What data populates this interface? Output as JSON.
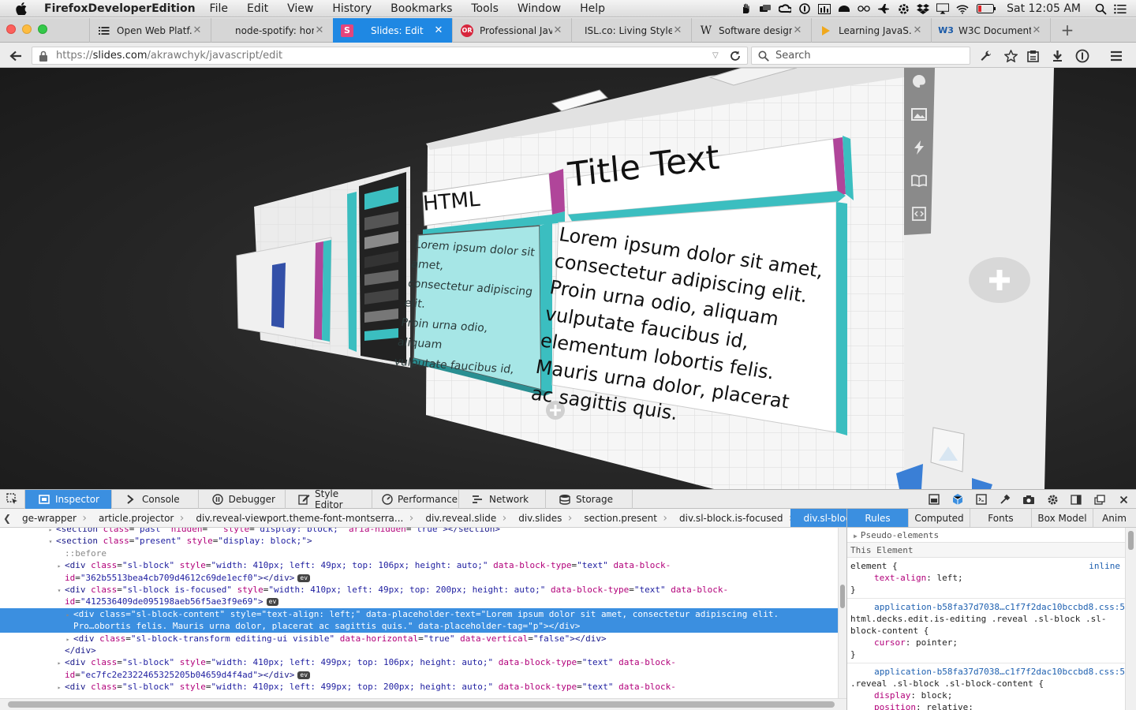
{
  "menubar": {
    "app_name": "FirefoxDeveloperEdition",
    "items": [
      "File",
      "Edit",
      "View",
      "History",
      "Bookmarks",
      "Tools",
      "Window",
      "Help"
    ],
    "clock": "Sat 12:05 AM"
  },
  "tabs": [
    {
      "label": "Open Web Platf...",
      "icon": "list-icon",
      "active": false
    },
    {
      "label": "node-spotify: home",
      "icon": "",
      "active": false
    },
    {
      "label": "Slides: Edit",
      "icon": "slides-s-icon",
      "active": true
    },
    {
      "label": "Professional Jav...",
      "icon": "red-badge-icon",
      "active": false
    },
    {
      "label": "ISL.co: Living Style ...",
      "icon": "",
      "active": false
    },
    {
      "label": "Software design...",
      "icon": "wikipedia-w-icon",
      "active": false
    },
    {
      "label": "Learning JavaS...",
      "icon": "yellow-arrow-icon",
      "active": false
    },
    {
      "label": "W3C Document ...",
      "icon": "w3c-icon",
      "active": false
    }
  ],
  "navbar": {
    "url_prefix": "https://",
    "url_host": "slides.com",
    "url_path": "/akrawchyk/javascript/edit",
    "search_placeholder": "Search"
  },
  "slide": {
    "title": "Title Text",
    "html_label": "HTML",
    "body": "Lorem ipsum dolor sit amet,\nconsectetur adipiscing elit.\nProin urna odio, aliquam\nvulputate faucibus id,\nelementum lobortis felis.\nMauris urna dolor, placerat\nac sagittis quis.",
    "small_body": "Lorem ipsum dolor sit amet,\nconsectetur adipiscing elit.\nProin urna odio, aliquam\nvulputate faucibus id,\nelementum lobortis felis.\nMauris urna dolor, placerat\nac sagittis quis."
  },
  "devtools": {
    "tabs": [
      {
        "label": "Inspector",
        "icon": "inspector-icon",
        "active": true
      },
      {
        "label": "Console",
        "icon": "console-icon",
        "active": false
      },
      {
        "label": "Debugger",
        "icon": "debugger-icon",
        "active": false
      },
      {
        "label": "Style Editor",
        "icon": "style-editor-icon",
        "active": false
      },
      {
        "label": "Performance",
        "icon": "performance-icon",
        "active": false
      },
      {
        "label": "Network",
        "icon": "network-icon",
        "active": false
      },
      {
        "label": "Storage",
        "icon": "storage-icon",
        "active": false
      }
    ],
    "breadcrumbs": [
      "ge-wrapper",
      "article.projector",
      "div.reveal-viewport.theme-font-montserra...",
      "div.reveal.slide",
      "div.slides",
      "section.present",
      "div.sl-block.is-focused",
      "div.sl-block-content"
    ],
    "markup": [
      {
        "indent": 1,
        "twisty": "▸",
        "html": "<span class=\"tag\">&lt;section</span> <span class=\"an\">class</span>=<span class=\"av\">\"past\"</span> <span class=\"an\">hidden</span>=<span class=\"av\">\"\"</span> <span class=\"an\">style</span>=<span class=\"av\">\"display: block;\"</span> <span class=\"an\">aria-hidden</span>=<span class=\"av\">\"true\"</span><span class=\"tag\">&gt;&lt;/section&gt;</span>"
      },
      {
        "indent": 1,
        "twisty": "▾",
        "html": "<span class=\"tag\">&lt;section</span> <span class=\"an\">class</span>=<span class=\"av\">\"present\"</span> <span class=\"an\">style</span>=<span class=\"av\">\"display: block;\"</span><span class=\"tag\">&gt;</span>"
      },
      {
        "indent": 2,
        "twisty": "",
        "html": "<span class=\"pe\">::before</span>"
      },
      {
        "indent": 2,
        "twisty": "▸",
        "html": "<span class=\"tag\">&lt;div</span> <span class=\"an\">class</span>=<span class=\"av\">\"sl-block\"</span> <span class=\"an\">style</span>=<span class=\"av\">\"width: 410px; left: 49px; top: 106px; height: auto;\"</span> <span class=\"an\">data-block-type</span>=<span class=\"av\">\"text\"</span> <span class=\"an\">data-block-</span>"
      },
      {
        "indent": 2,
        "twisty": "",
        "html": "<span class=\"an\">id</span>=<span class=\"av\">\"362b5513bea4cb709d4612c69de1ecf0\"</span><span class=\"tag\">&gt;&lt;/div&gt;</span><span class=\"evb\">ev</span>"
      },
      {
        "indent": 2,
        "twisty": "▾",
        "html": "<span class=\"tag\">&lt;div</span> <span class=\"an\">class</span>=<span class=\"av\">\"sl-block is-focused\"</span> <span class=\"an\">style</span>=<span class=\"av\">\"width: 410px; left: 49px; top: 200px; height: auto;\"</span> <span class=\"an\">data-block-type</span>=<span class=\"av\">\"text\"</span> <span class=\"an\">data-block-</span>"
      },
      {
        "indent": 2,
        "twisty": "",
        "html": "<span class=\"an\">id</span>=<span class=\"av\">\"412536409de095198aeb56f5ae3f9e69\"</span><span class=\"tag\">&gt;</span><span class=\"evb\">ev</span>"
      },
      {
        "indent": 3,
        "twisty": "▸",
        "sel": true,
        "html": "<span class=\"tag\">&lt;div</span> <span class=\"an\">class</span>=<span class=\"av\">\"sl-block-content\"</span> <span class=\"an\">style</span>=<span class=\"av\">\"text-align: left;\"</span> <span class=\"an\">data-placeholder-text</span>=<span class=\"av\">\"Lorem ipsum dolor sit amet, consectetur adipiscing elit.</span>"
      },
      {
        "indent": 3,
        "twisty": "",
        "sel": true,
        "html": "<span class=\"av\">Pro…obortis felis. Mauris urna dolor, placerat ac sagittis quis.\"</span> <span class=\"an\">data-placeholder-tag</span>=<span class=\"av\">\"p\"</span><span class=\"tag\">&gt;&lt;/div&gt;</span>"
      },
      {
        "indent": 3,
        "twisty": "▸",
        "html": "<span class=\"tag\">&lt;div</span> <span class=\"an\">class</span>=<span class=\"av\">\"sl-block-transform editing-ui visible\"</span> <span class=\"an\">data-horizontal</span>=<span class=\"av\">\"true\"</span> <span class=\"an\">data-vertical</span>=<span class=\"av\">\"false\"</span><span class=\"tag\">&gt;&lt;/div&gt;</span>"
      },
      {
        "indent": 2,
        "twisty": "",
        "html": "<span class=\"tag\">&lt;/div&gt;</span>"
      },
      {
        "indent": 2,
        "twisty": "▸",
        "html": "<span class=\"tag\">&lt;div</span> <span class=\"an\">class</span>=<span class=\"av\">\"sl-block\"</span> <span class=\"an\">style</span>=<span class=\"av\">\"width: 410px; left: 499px; top: 106px; height: auto;\"</span> <span class=\"an\">data-block-type</span>=<span class=\"av\">\"text\"</span> <span class=\"an\">data-block-</span>"
      },
      {
        "indent": 2,
        "twisty": "",
        "html": "<span class=\"an\">id</span>=<span class=\"av\">\"ec7fc2e2322465325205b04659d4f4ad\"</span><span class=\"tag\">&gt;&lt;/div&gt;</span><span class=\"evb\">ev</span>"
      },
      {
        "indent": 2,
        "twisty": "▸",
        "html": "<span class=\"tag\">&lt;div</span> <span class=\"an\">class</span>=<span class=\"av\">\"sl-block\"</span> <span class=\"an\">style</span>=<span class=\"av\">\"width: 410px; left: 499px; top: 200px; height: auto;\"</span> <span class=\"an\">data-block-type</span>=<span class=\"av\">\"text\"</span> <span class=\"an\">data-block-</span>"
      }
    ],
    "sidebar": {
      "tabs": [
        {
          "label": "Rules",
          "active": true
        },
        {
          "label": "Computed",
          "active": false
        },
        {
          "label": "Fonts",
          "active": false
        },
        {
          "label": "Box Model",
          "active": false
        },
        {
          "label": "Anim",
          "active": false
        }
      ],
      "pseudo_label": "Pseudo-elements",
      "this_element_label": "This Element",
      "rules": [
        {
          "selector": "element {",
          "source": "inline",
          "decls": [
            [
              "text-align",
              "left"
            ]
          ]
        },
        {
          "selector": "html.decks.edit.is-editing .reveal .sl-block .sl-block-content {",
          "source": "application-b58fa37d7038…c1f7f2dac10bccbd8.css:5",
          "decls": [
            [
              "cursor",
              "pointer"
            ]
          ]
        },
        {
          "selector": ".reveal .sl-block .sl-block-content {",
          "source": "application-b58fa37d7038…c1f7f2dac10bccbd8.css:5",
          "decls": [
            [
              "display",
              "block"
            ],
            [
              "position",
              "relative"
            ]
          ]
        }
      ]
    }
  },
  "colors": {
    "accent_blue": "#3b8fe0",
    "tab_active": "#1f88e3",
    "slide_accent_cyan": "#3bbec0",
    "slide_accent_magenta": "#b0459a"
  }
}
